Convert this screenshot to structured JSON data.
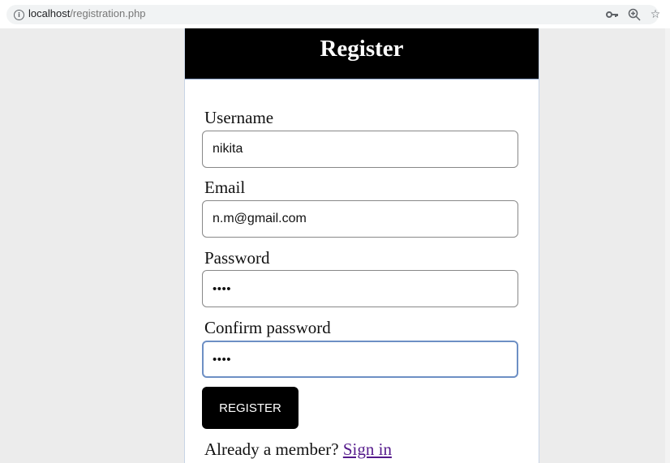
{
  "browser": {
    "url_host": "localhost",
    "url_path": "/registration.php",
    "icons": [
      "info-icon",
      "key-icon",
      "zoom-icon",
      "star-icon"
    ]
  },
  "form": {
    "title": "Register",
    "fields": [
      {
        "label": "Username",
        "value": "nikita",
        "type": "text"
      },
      {
        "label": "Email",
        "value": "n.m@gmail.com",
        "type": "text"
      },
      {
        "label": "Password",
        "value": "••••",
        "type": "password"
      },
      {
        "label": "Confirm password",
        "value": "••••",
        "type": "password",
        "focused": true
      }
    ],
    "submit_label": "REGISTER",
    "member_prompt": "Already a member?",
    "signin_label": "Sign in"
  },
  "colors": {
    "header_bg": "#000000",
    "page_bg": "#ececec",
    "focus_border": "#6d8fc4",
    "link": "#551a8b"
  }
}
